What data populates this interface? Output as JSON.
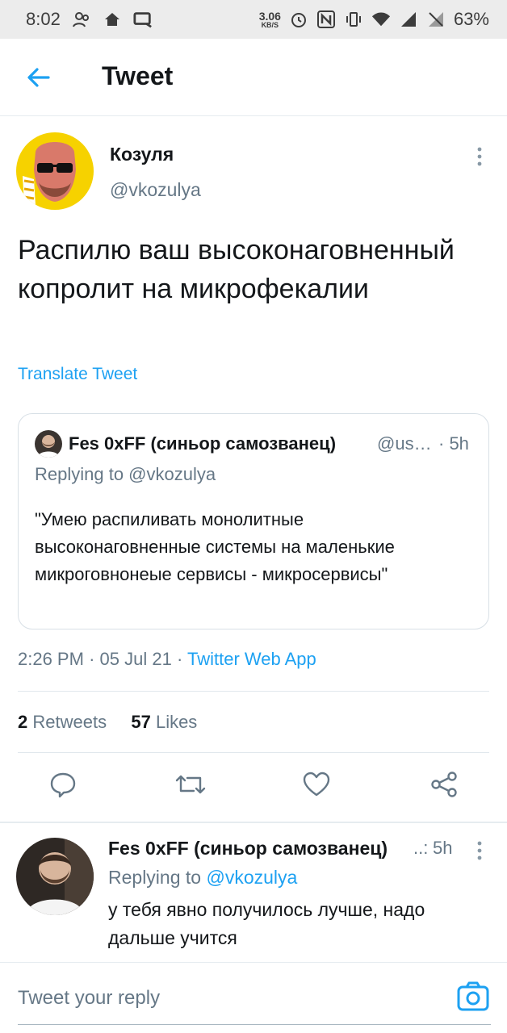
{
  "status_bar": {
    "time": "8:02",
    "speed_value": "3.06",
    "speed_unit": "KB/S",
    "battery": "63%"
  },
  "header": {
    "title": "Tweet"
  },
  "tweet": {
    "author_name": "Козуля",
    "author_handle": "@vkozulya",
    "text": "Распилю ваш высоконаговненный копролит на микрофекалии",
    "translate_label": "Translate Tweet",
    "time": "2:26 PM",
    "date": "05 Jul 21",
    "source_app": "Twitter Web App",
    "retweets_count": "2",
    "retweets_label": "Retweets",
    "likes_count": "57",
    "likes_label": "Likes"
  },
  "quoted_tweet": {
    "author_name": "Fes 0xFF (синьор самозванец)",
    "author_handle": "@us…",
    "time": "· 5h",
    "replying_to": "Replying to @vkozulya",
    "text": "\"Умею распиливать монолитные высоконаговненные системы на маленькие микроговнонеые сервисы - микросервисы\""
  },
  "reply": {
    "author_name": "Fes 0xFF (синьор самозванец)",
    "handle_trunc": "..:",
    "time": "5h",
    "replying_to_label": "Replying to",
    "replying_to_handle": "@vkozulya",
    "text": "у тебя явно получилось лучше, надо дальше учится"
  },
  "composer": {
    "placeholder": "Tweet your reply"
  },
  "icons": {
    "back": "arrow-left-icon",
    "more": "more-vertical-icon",
    "reply": "reply-icon",
    "retweet": "retweet-icon",
    "like": "heart-icon",
    "share": "share-icon",
    "camera": "camera-icon"
  },
  "colors": {
    "accent": "#1da1f2",
    "secondary_text": "#657786",
    "primary_text": "#14171a",
    "avatar_bg": "#f6d200"
  }
}
